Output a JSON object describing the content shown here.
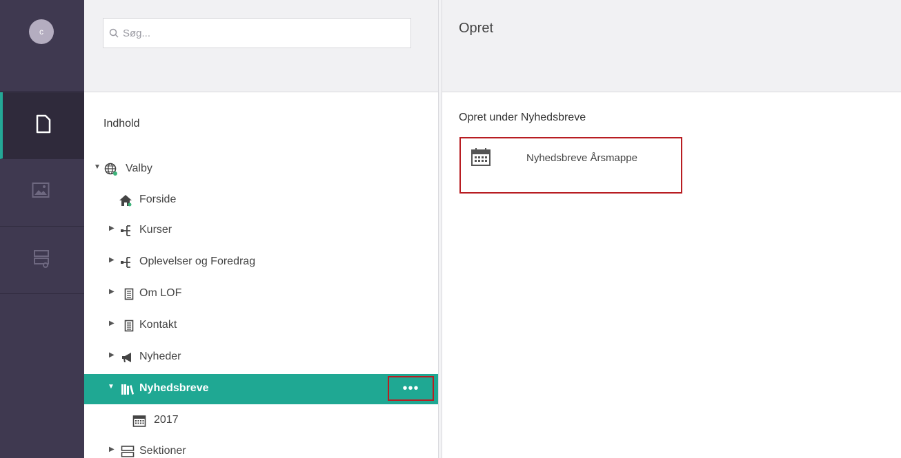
{
  "user": {
    "avatar_initial": "c"
  },
  "rail": {
    "sections": [
      {
        "name": "content",
        "icon": "document-icon",
        "active": true
      },
      {
        "name": "media",
        "icon": "image-icon",
        "active": false
      },
      {
        "name": "settings",
        "icon": "server-settings-icon",
        "active": false
      }
    ],
    "accent": "#24a896"
  },
  "search": {
    "placeholder": "Søg...",
    "value": ""
  },
  "tree": {
    "title": "Indhold",
    "nodes": [
      {
        "label": "Valby",
        "icon": "globe-icon",
        "expanded": true
      },
      {
        "label": "Forside",
        "icon": "home-icon"
      },
      {
        "label": "Kurser",
        "icon": "sitemap-icon",
        "expandable": true
      },
      {
        "label": "Oplevelser og Foredrag",
        "icon": "sitemap-icon",
        "expandable": true
      },
      {
        "label": "Om LOF",
        "icon": "document-list-icon",
        "expandable": true
      },
      {
        "label": "Kontakt",
        "icon": "document-list-icon",
        "expandable": true
      },
      {
        "label": "Nyheder",
        "icon": "megaphone-icon",
        "expandable": true
      },
      {
        "label": "Nyhedsbreve",
        "icon": "books-icon",
        "expanded": true,
        "selected": true,
        "actions_label": "•••"
      },
      {
        "label": "2017",
        "icon": "calendar-icon"
      },
      {
        "label": "Sektioner",
        "icon": "server-icon",
        "expandable": true
      }
    ],
    "selected_color": "#1fa893"
  },
  "create": {
    "title": "Opret",
    "subtitle": "Opret under Nyhedsbreve",
    "doctypes": [
      {
        "label": "Nyhedsbreve Årsmappe",
        "icon": "calendar-icon"
      }
    ],
    "highlight_color": "#b81d22"
  }
}
